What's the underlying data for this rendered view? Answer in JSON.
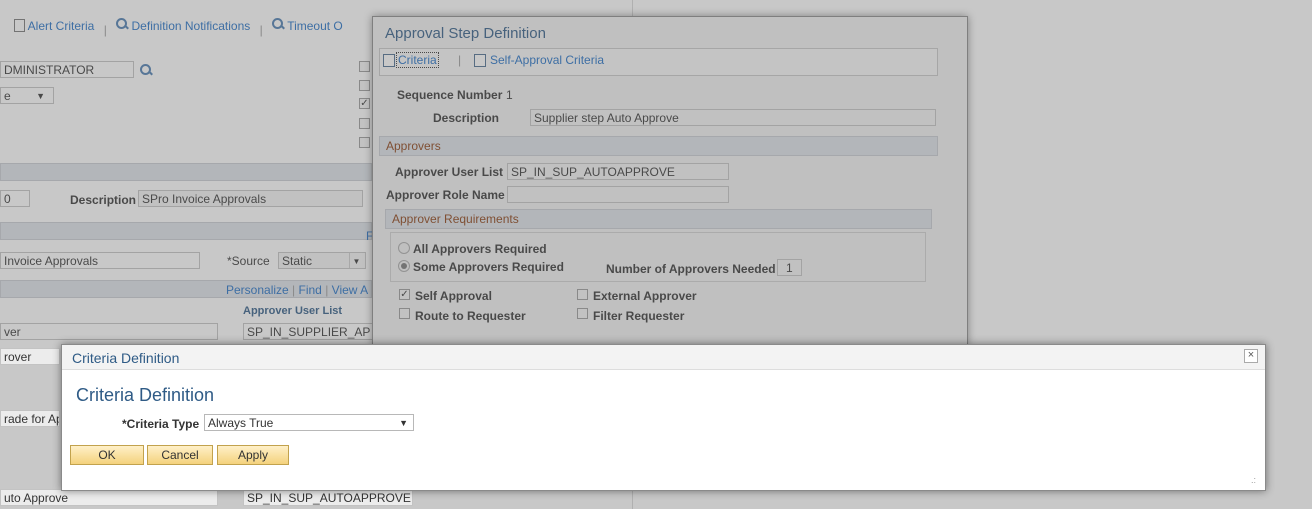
{
  "bg_tabs": {
    "alert_criteria": "Alert Criteria",
    "definition_notifications": "Definition Notifications",
    "timeout": "Timeout O"
  },
  "bg": {
    "admin_value": "DMINISTRATOR",
    "dropdown_value": "e",
    "id_value": "0",
    "description_label": "Description",
    "description_value": "SPro Invoice Approvals",
    "invoice_value": "Invoice Approvals",
    "source_label": "*Source",
    "source_value": "Static",
    "source_right_char": "F",
    "grid_links": {
      "personalize": "Personalize",
      "find": "Find",
      "view": "View A"
    },
    "grid_header": "Approver User List",
    "rows": [
      {
        "left": "ver",
        "right": "SP_IN_SUPPLIER_AP"
      },
      {
        "left": "rover",
        "right": ""
      },
      {
        "left": "rade for Ap",
        "right": ""
      },
      {
        "left": "uto Approve",
        "right": "SP_IN_SUP_AUTOAPPROVE"
      }
    ]
  },
  "approval_modal": {
    "title": "Approval Step Definition",
    "tabs": {
      "criteria": "Criteria",
      "separator": "|",
      "self_approval": "Self-Approval Criteria"
    },
    "sequence_label": "Sequence Number",
    "sequence_value": "1",
    "description_label": "Description",
    "description_value": "Supplier step Auto Approve",
    "approvers_header": "Approvers",
    "approver_user_list_label": "Approver User List",
    "approver_user_list_value": "SP_IN_SUP_AUTOAPPROVE",
    "approver_role_label": "Approver Role Name",
    "approver_role_value": "",
    "requirements_header": "Approver Requirements",
    "all_required": "All Approvers Required",
    "some_required": "Some Approvers Required",
    "number_needed_label": "Number of Approvers Needed",
    "number_needed_value": "1",
    "self_approval": "Self Approval",
    "external_approver": "External Approver",
    "route_requester": "Route to Requester",
    "filter_requester": "Filter Requester"
  },
  "criteria_modal": {
    "titlebar": "Criteria Definition",
    "heading": "Criteria Definition",
    "criteria_type_label": "*Criteria Type",
    "criteria_type_value": "Always True",
    "ok": "OK",
    "cancel": "Cancel",
    "apply": "Apply",
    "close_symbol": "×",
    "resize_symbol": ".:"
  },
  "colors": {
    "link": "#1f6ec5",
    "section_bar": "#dde2e8",
    "button": "#f4d27d",
    "modal_title": "#2f5b86"
  }
}
